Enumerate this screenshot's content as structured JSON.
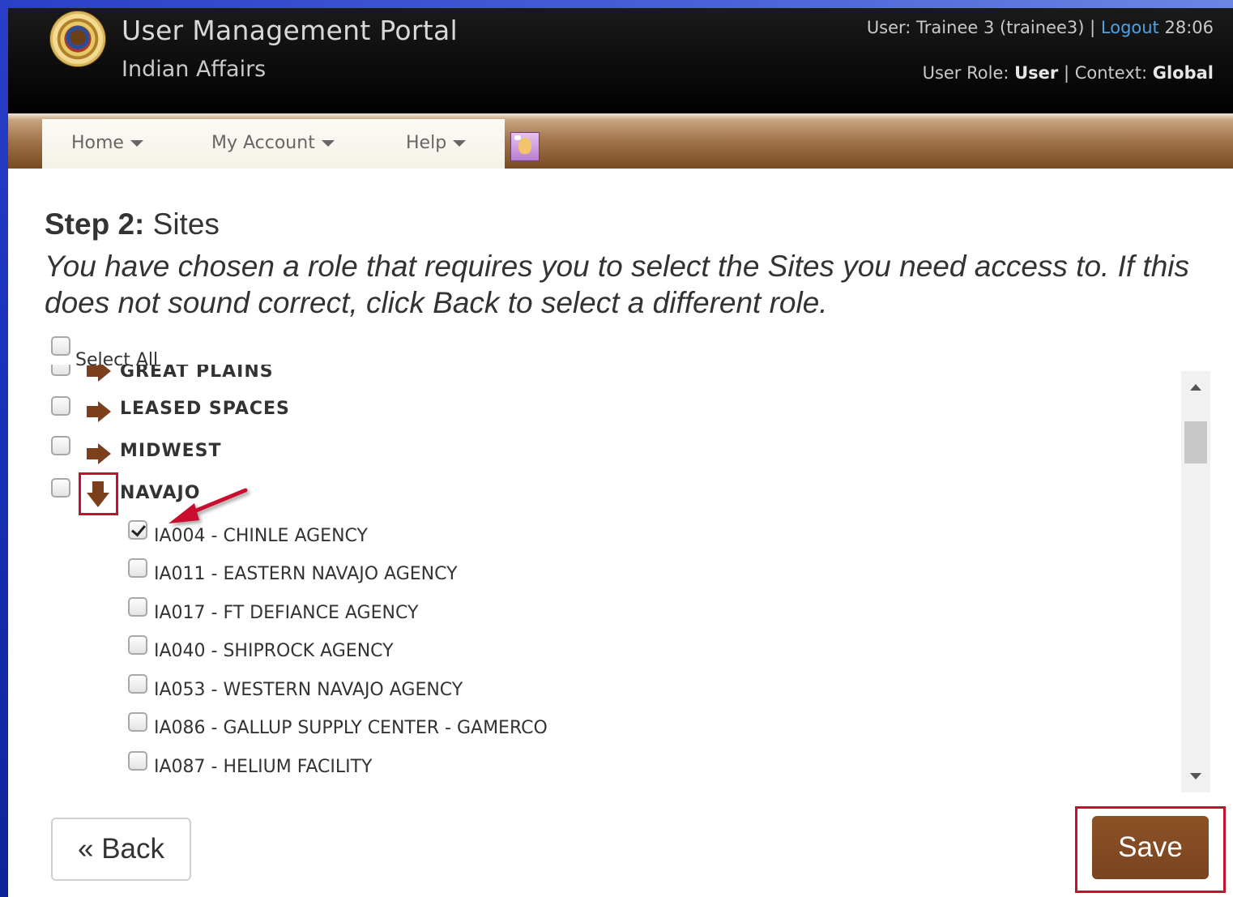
{
  "header": {
    "app_title": "User Management Portal",
    "app_subtitle": "Indian Affairs",
    "user_prefix": "User: Trainee 3 (trainee3) | ",
    "logout_label": "Logout",
    "session_timer": " 28:06",
    "role_prefix": "User Role: ",
    "role_value": "User",
    "context_prefix": " | Context: ",
    "context_value": "Global"
  },
  "nav": {
    "items": [
      {
        "label": "Home"
      },
      {
        "label": "My Account"
      },
      {
        "label": "Help"
      }
    ],
    "feedback_icon": "feedback-icon"
  },
  "step": {
    "step_label": "Step 2:",
    "step_name": " Sites",
    "instructions": "You have chosen a role that requires you to select the Sites you need access to. If this does not sound correct, click Back to select a different role."
  },
  "select_all_label": "Select All",
  "regions": [
    {
      "label": "GREAT PLAINS",
      "expanded": false,
      "checked": false
    },
    {
      "label": "LEASED SPACES",
      "expanded": false,
      "checked": false
    },
    {
      "label": "MIDWEST",
      "expanded": false,
      "checked": false
    },
    {
      "label": "NAVAJO",
      "expanded": true,
      "checked": false
    }
  ],
  "navajo_sites": [
    {
      "label": "IA004 - CHINLE AGENCY",
      "checked": true
    },
    {
      "label": "IA011 - EASTERN NAVAJO AGENCY",
      "checked": false
    },
    {
      "label": "IA017 - FT DEFIANCE AGENCY",
      "checked": false
    },
    {
      "label": "IA040 - SHIPROCK AGENCY",
      "checked": false
    },
    {
      "label": "IA053 - WESTERN NAVAJO AGENCY",
      "checked": false
    },
    {
      "label": "IA086 - GALLUP SUPPLY CENTER - GAMERCO",
      "checked": false
    },
    {
      "label": "IA087 - HELIUM FACILITY",
      "checked": false
    }
  ],
  "buttons": {
    "back": "« Back",
    "save": "Save"
  },
  "colors": {
    "accent_brown": "#7b3f1c",
    "annotation_red": "#c8102e",
    "link_blue": "#4aa3e8"
  }
}
